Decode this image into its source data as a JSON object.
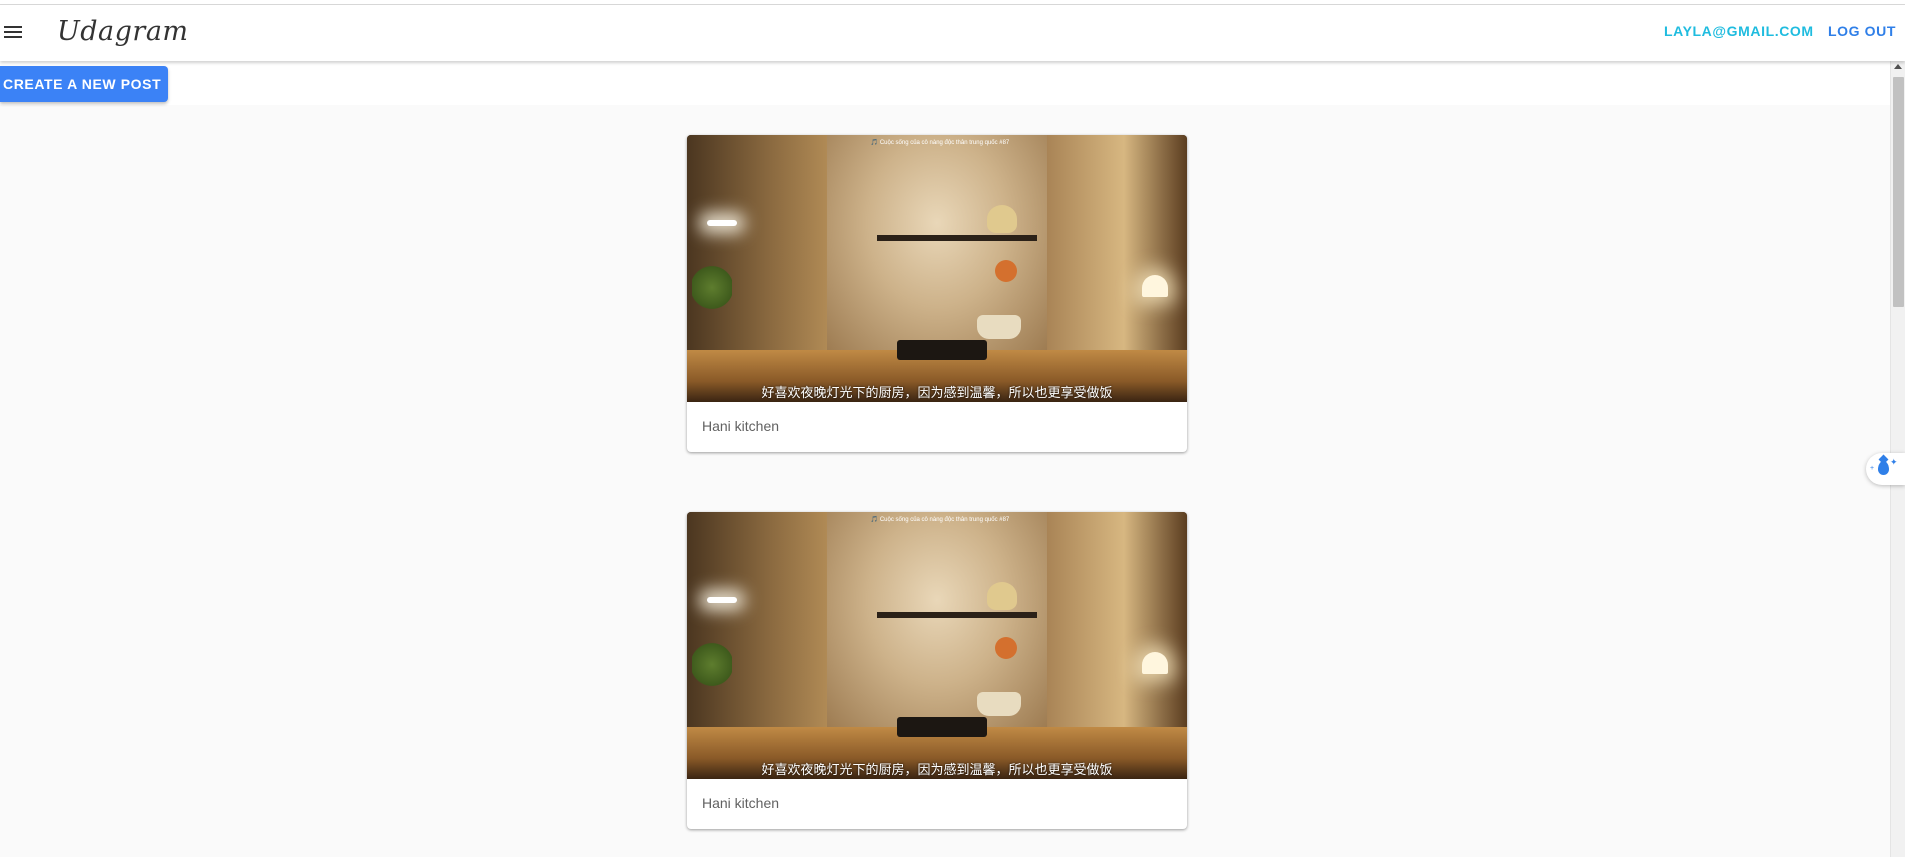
{
  "app": {
    "brand": "Udagram"
  },
  "header": {
    "user_email": "LAYLA@GMAIL.COM",
    "logout_label": "LOG OUT"
  },
  "actions": {
    "create_post_label": "CREATE A NEW POST"
  },
  "feed": {
    "posts": [
      {
        "caption": "Hani kitchen",
        "image_overlay_title": "🎵 Cuộc sống của cô nàng độc thân trung quốc #87",
        "image_subtitle": "好喜欢夜晚灯光下的厨房，因为感到温馨，所以也更享受做饭"
      },
      {
        "caption": "Hani kitchen",
        "image_overlay_title": "🎵 Cuộc sống của cô nàng độc thân trung quốc #87",
        "image_subtitle": "好喜欢夜晚灯光下的厨房，因为感到温馨，所以也更享受做饭"
      }
    ]
  },
  "icons": {
    "menu": "menu-icon",
    "widget": "water-drop-sparkle-icon"
  },
  "colors": {
    "accent_email": "#1fbcdf",
    "accent_logout": "#2f7fe8",
    "create_button": "#3b82f6",
    "background": "#fafafa"
  }
}
